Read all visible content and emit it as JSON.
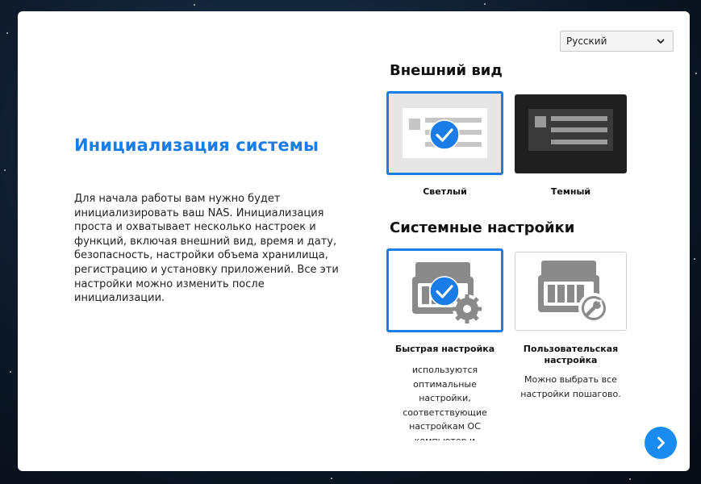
{
  "language": {
    "selected": "Русский"
  },
  "intro": {
    "title": "Инициализация системы",
    "text": "Для начала работы вам нужно будет инициализировать ваш NAS. Инициализация проста и охватывает несколько настроек и функций, включая внешний вид, время и дату, безопасность, настройки объема хранилища, регистрацию и установку приложений. Все эти настройки можно изменить после инициализации."
  },
  "appearance": {
    "title": "Внешний вид",
    "options": [
      {
        "label": "Светлый",
        "selected": true
      },
      {
        "label": "Темный",
        "selected": false
      }
    ]
  },
  "system_settings": {
    "title": "Системные настройки",
    "options": [
      {
        "label": "Быстрая настройка",
        "description": "используются оптимальные настройки, соответствующие настройкам ОС компьютер и установленным жестким",
        "selected": true
      },
      {
        "label": "Пользовательская настройка",
        "description": "Можно выбрать все настройки пошагово.",
        "selected": false
      }
    ]
  },
  "colors": {
    "accent": "#1a7ce6",
    "button": "#1a8cf0",
    "dark_theme_bg": "#2b2b2b"
  },
  "icons": {
    "next": "chevron-right-icon",
    "selected_check": "check-circle-icon",
    "dropdown": "chevron-down-icon",
    "quick_setup": "nas-gear-icon",
    "custom_setup": "nas-wrench-icon"
  }
}
